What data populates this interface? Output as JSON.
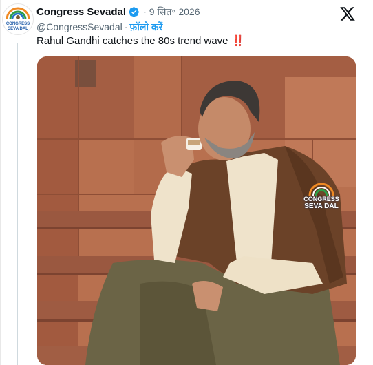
{
  "tweet": {
    "display_name": "Congress Sevadal",
    "verified": true,
    "date": "9 सित॰ 2026",
    "handle": "@CongressSevadal",
    "follow_label": "फ़ॉलो करें",
    "text": "Rahul Gandhi catches the 80s trend wave",
    "text_emoji": "‼️"
  },
  "avatar": {
    "logo_line1": "CONGRESS",
    "logo_line2": "SEVA DAL"
  },
  "media": {
    "watermark_line1": "CONGRESS",
    "watermark_line2": "SEVA DAL"
  },
  "icons": {
    "brand": "x-logo-icon",
    "verified": "verified-badge-icon"
  },
  "colors": {
    "link": "#1d9bf0",
    "text": "#0f1419",
    "muted": "#536471",
    "verified": "#1d9bf0",
    "emoji": "#d41f2a"
  }
}
